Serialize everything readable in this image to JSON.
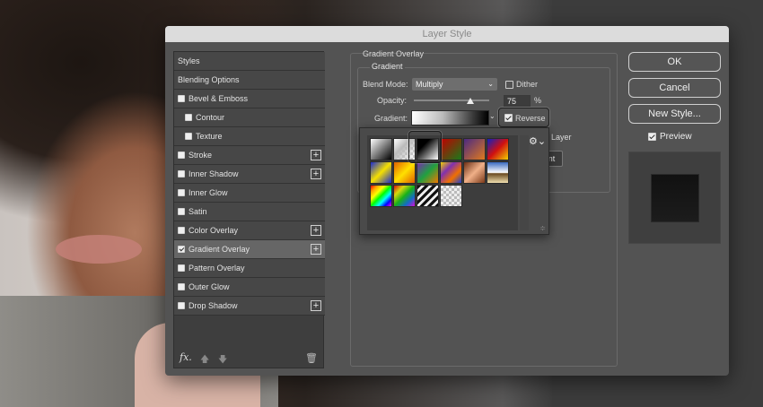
{
  "window": {
    "title": "Layer Style"
  },
  "styles_list": {
    "header": "Styles",
    "items": [
      {
        "label": "Blending Options",
        "checkbox": null,
        "plus": false,
        "indent": false,
        "selected": false
      },
      {
        "label": "Bevel & Emboss",
        "checkbox": false,
        "plus": false,
        "indent": false,
        "selected": false
      },
      {
        "label": "Contour",
        "checkbox": false,
        "plus": false,
        "indent": true,
        "selected": false
      },
      {
        "label": "Texture",
        "checkbox": false,
        "plus": false,
        "indent": true,
        "selected": false
      },
      {
        "label": "Stroke",
        "checkbox": false,
        "plus": true,
        "indent": false,
        "selected": false
      },
      {
        "label": "Inner Shadow",
        "checkbox": false,
        "plus": true,
        "indent": false,
        "selected": false
      },
      {
        "label": "Inner Glow",
        "checkbox": false,
        "plus": false,
        "indent": false,
        "selected": false
      },
      {
        "label": "Satin",
        "checkbox": false,
        "plus": false,
        "indent": false,
        "selected": false
      },
      {
        "label": "Color Overlay",
        "checkbox": false,
        "plus": true,
        "indent": false,
        "selected": false
      },
      {
        "label": "Gradient Overlay",
        "checkbox": true,
        "plus": true,
        "indent": false,
        "selected": true
      },
      {
        "label": "Pattern Overlay",
        "checkbox": false,
        "plus": false,
        "indent": false,
        "selected": false
      },
      {
        "label": "Outer Glow",
        "checkbox": false,
        "plus": false,
        "indent": false,
        "selected": false
      },
      {
        "label": "Drop Shadow",
        "checkbox": false,
        "plus": true,
        "indent": false,
        "selected": false
      }
    ],
    "footer": {
      "fx_label": "fx",
      "fx_suffix": "."
    }
  },
  "gradient_overlay": {
    "section_title": "Gradient Overlay",
    "group_title": "Gradient",
    "blend_mode_label": "Blend Mode:",
    "blend_mode_value": "Multiply",
    "dither_label": "Dither",
    "dither_checked": false,
    "opacity_label": "Opacity:",
    "opacity_value": "75",
    "opacity_unit": "%",
    "opacity_fraction": 0.75,
    "gradient_label": "Gradient:",
    "reverse_label": "Reverse",
    "reverse_checked": true,
    "partial_layer_text": "Layer",
    "partial_button_text": "nt"
  },
  "gradient_presets": [
    {
      "name": "white-to-black",
      "css": "linear-gradient(135deg,#ffffff,#000000)"
    },
    {
      "name": "foreground-to-transparent",
      "css": "linear-gradient(135deg,#ffffff 0%,#bbbbbb 40%,rgba(0,0,0,0) 100%), repeating-conic-gradient(#ccc 0 25%, #fff 0 50%) 0 0/6px 6px"
    },
    {
      "name": "black-to-white",
      "css": "linear-gradient(135deg,#000000 30%,#ffffff)"
    },
    {
      "name": "red-green",
      "css": "linear-gradient(135deg,#c00000,#1a7a1a)"
    },
    {
      "name": "violet-orange",
      "css": "linear-gradient(135deg,#4b2a82,#e07a1e)"
    },
    {
      "name": "blue-red-yellow",
      "css": "linear-gradient(135deg,#1020c0,#d01010,#f0d000)"
    },
    {
      "name": "blue-yellow-blue",
      "css": "linear-gradient(135deg,#1b2ad0,#f5e000,#1b2ad0)"
    },
    {
      "name": "orange-yellow-orange",
      "css": "linear-gradient(135deg,#e06000,#ffe000,#e06000)"
    },
    {
      "name": "violet-green-orange",
      "css": "linear-gradient(135deg,#7a2ab0,#20a040,#f07a00)"
    },
    {
      "name": "yellow-violet-orange-blue",
      "css": "linear-gradient(135deg,#f0d000,#8030b0,#f07000,#2040d0)"
    },
    {
      "name": "copper",
      "css": "linear-gradient(135deg,#6b2e14,#f0b088,#7a3818)"
    },
    {
      "name": "chrome",
      "css": "linear-gradient(180deg,#3a6ac0,#ffffff 50%,#6a4a20 55%,#f0e0b0)"
    },
    {
      "name": "spectrum",
      "css": "linear-gradient(135deg,red,orange,yellow,lime,cyan,blue,magenta)"
    },
    {
      "name": "transparent-rainbow",
      "css": "linear-gradient(135deg,rgba(255,0,0,.8),rgba(255,255,0,.8),rgba(0,255,0,.6),rgba(0,128,255,.7),rgba(255,0,255,.8))"
    },
    {
      "name": "transparent-stripes",
      "css": "repeating-linear-gradient(135deg,#111 0 3px,#eee 3px 6px)"
    },
    {
      "name": "transparent",
      "css": "repeating-conic-gradient(#bbb 0 25%, #eee 0 50%) 0 0/6px 6px"
    }
  ],
  "buttons": {
    "ok": "OK",
    "cancel": "Cancel",
    "new_style": "New Style..."
  },
  "preview": {
    "label": "Preview",
    "checked": true
  }
}
